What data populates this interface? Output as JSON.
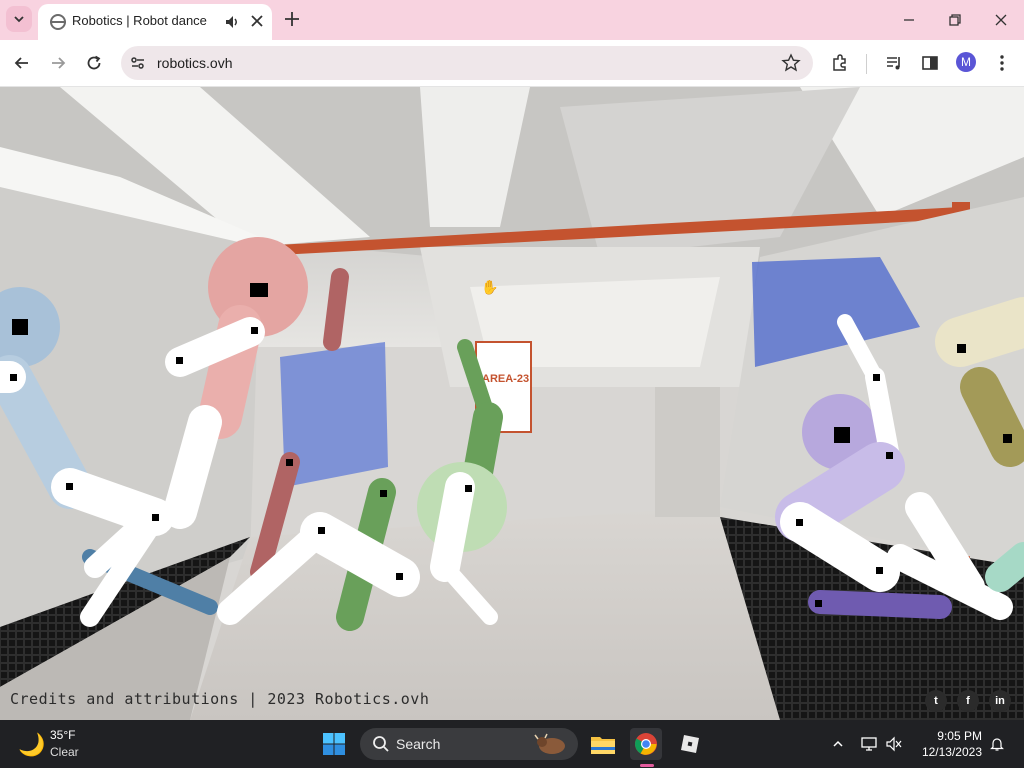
{
  "browser": {
    "tab": {
      "title": "Robotics | Robot dance"
    },
    "omnibox": {
      "url": "robotics.ovh"
    },
    "profile_initial": "M"
  },
  "page": {
    "credits": "Credits and attributions | 2023 Robotics.ovh",
    "sign_text": "AREA-23",
    "social": [
      "twitter",
      "facebook",
      "linkedin"
    ]
  },
  "taskbar": {
    "weather": {
      "temp": "35°F",
      "condition": "Clear"
    },
    "search_label": "Search",
    "time": "9:05 PM",
    "date": "12/13/2023"
  },
  "colors": {
    "tabstrip": "#f8d3e0",
    "taskbar": "#202124",
    "robot_pink": "#e4a5a2",
    "robot_blue": "#a8c1d8",
    "robot_green": "#69a05a",
    "robot_purple": "#b7a8dd",
    "robot_olive": "#a39a58"
  }
}
